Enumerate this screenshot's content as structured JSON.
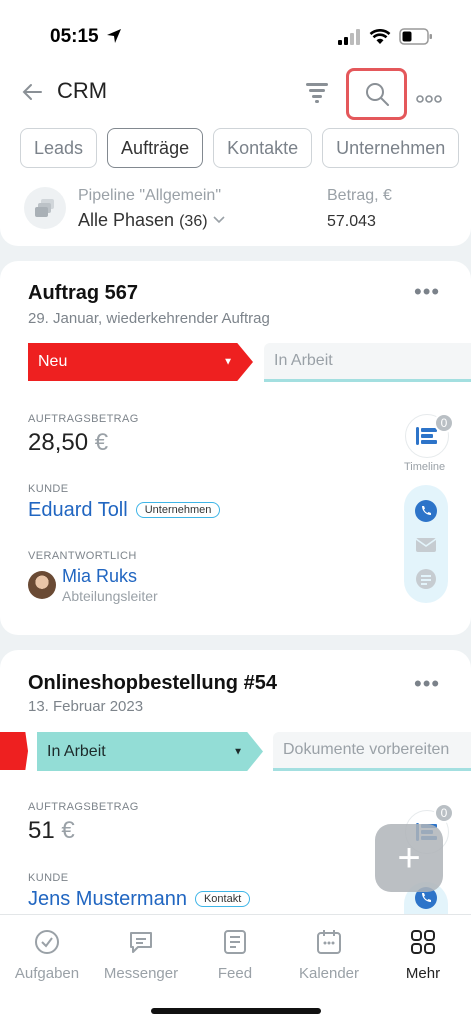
{
  "status_bar": {
    "time": "05:15"
  },
  "header": {
    "back_icon": "arrow-left-icon",
    "title": "CRM",
    "filter_icon": "filter-icon",
    "search_icon": "search-icon",
    "more_icon": "more-horizontal-icon"
  },
  "tabs": [
    {
      "label": "Leads",
      "active": false
    },
    {
      "label": "Aufträge",
      "active": true
    },
    {
      "label": "Kontakte",
      "active": false
    },
    {
      "label": "Unternehmen",
      "active": false
    }
  ],
  "pipeline": {
    "label": "Pipeline \"Allgemein\"",
    "value": "Alle Phasen",
    "count": "(36)",
    "amount_label": "Betrag, €",
    "amount_value": "57.043"
  },
  "cards": [
    {
      "title": "Auftrag 567",
      "subtitle": "29. Januar, wiederkehrender Auftrag",
      "stage": "Neu",
      "next_stage": "In Arbeit",
      "amount_label": "AUFTRAGSBETRAG",
      "amount": "28,50",
      "currency": "€",
      "client_label": "KUNDE",
      "client_name": "Eduard Toll",
      "client_badge": "Unternehmen",
      "responsible_label": "VERANTWORTLICH",
      "responsible_name": "Mia Ruks",
      "responsible_position": "Abteilungsleiter",
      "timeline_label": "Timeline",
      "timeline_count": "0"
    },
    {
      "title": "Onlineshopbestellung #54",
      "subtitle": "13. Februar 2023",
      "stage": "In Arbeit",
      "next_stage": "Dokumente vorbereiten",
      "amount_label": "AUFTRAGSBETRAG",
      "amount": "51",
      "currency": "€",
      "client_label": "KUNDE",
      "client_name": "Jens Mustermann",
      "client_badge": "Kontakt",
      "timeline_count": "0"
    }
  ],
  "fab": {
    "label": "+"
  },
  "bottom_nav": [
    {
      "label": "Aufgaben",
      "icon": "check-circle-icon",
      "active": false
    },
    {
      "label": "Messenger",
      "icon": "chat-icon",
      "active": false
    },
    {
      "label": "Feed",
      "icon": "feed-icon",
      "active": false
    },
    {
      "label": "Kalender",
      "icon": "calendar-icon",
      "active": false
    },
    {
      "label": "Mehr",
      "icon": "grid-icon",
      "active": true
    }
  ],
  "colors": {
    "accent_blue": "#2166c1",
    "stage_red": "#ee2020",
    "stage_teal": "#93ddd6",
    "search_highlight": "#e4585b"
  }
}
